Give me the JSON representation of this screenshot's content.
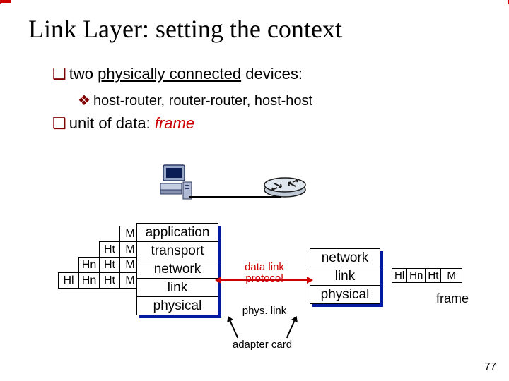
{
  "title": "Link Layer: setting the context",
  "bullets": {
    "b1_prefix": "two ",
    "b1_underlined": "physically connected",
    "b1_suffix": " devices:",
    "b1a": "host-router, router-router, host-host",
    "b2_prefix": "unit of data: ",
    "b2_red": "frame"
  },
  "stack_left": {
    "l0": "application",
    "l1": "transport",
    "l2": "network",
    "l3": "link",
    "l4": "physical"
  },
  "stack_right": {
    "l0": "network",
    "l1": "link",
    "l2": "physical"
  },
  "labels": {
    "datalink": "data link protocol",
    "physlink": "phys. link",
    "adapter": "adapter card",
    "frame": "frame",
    "slide_number": "77"
  },
  "headers": {
    "M": "M",
    "Ht": "Ht",
    "Hn": "Hn",
    "Hl": "Hl"
  },
  "frame_pkt": [
    "Hl",
    "Hn",
    "Ht",
    "M"
  ]
}
